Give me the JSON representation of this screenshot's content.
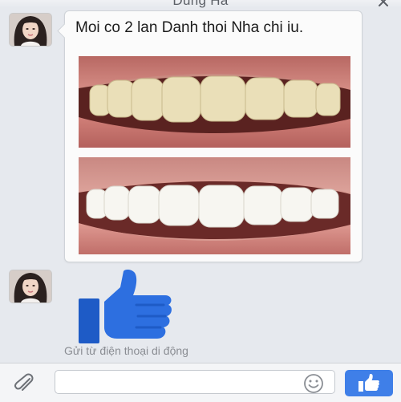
{
  "header": {
    "contact_name": "Dũng Hà",
    "close_icon": "close-icon"
  },
  "conversation": {
    "messages": [
      {
        "text": "Moi co 2 lan Danh thoi Nha chi iu.",
        "attachments": [
          {
            "icon": "teeth-before-photo"
          },
          {
            "icon": "teeth-after-photo"
          }
        ]
      },
      {
        "sticker": "thumbs-up-icon",
        "footer": "Gửi từ điện thoại di động"
      }
    ]
  },
  "composer": {
    "placeholder": "",
    "attach_icon": "paperclip-icon",
    "emoji_icon": "smiley-icon",
    "send_icon": "thumbs-up-icon"
  },
  "colors": {
    "background": "#e6e9ee",
    "bubble": "#fbfbfb",
    "like_blue": "#2d6fe0",
    "send_button": "#3f7fe8"
  }
}
